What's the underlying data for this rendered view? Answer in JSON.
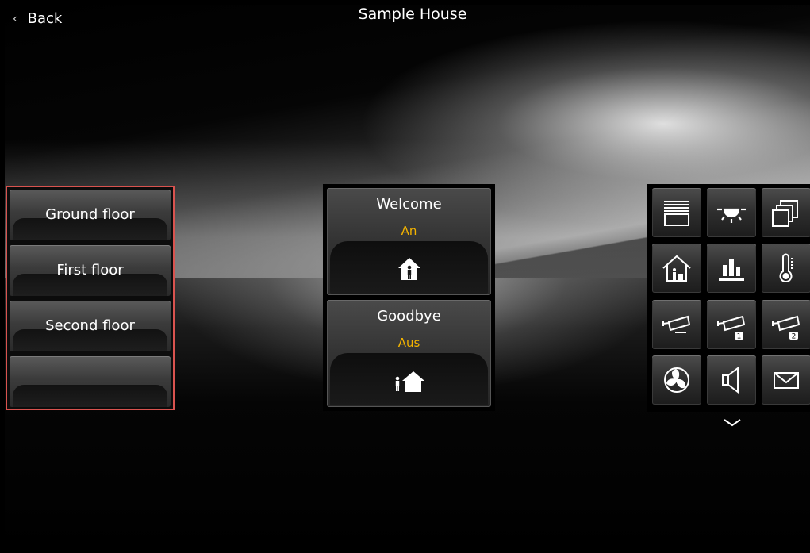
{
  "header": {
    "back_label": "Back",
    "title": "Sample House"
  },
  "floors": [
    {
      "label": "Ground floor"
    },
    {
      "label": "First floor"
    },
    {
      "label": "Second floor"
    },
    {
      "label": ""
    }
  ],
  "scenes": [
    {
      "name": "Welcome",
      "state": "An",
      "icon": "person-in-house-icon"
    },
    {
      "name": "Goodbye",
      "state": "Aus",
      "icon": "person-leaving-house-icon"
    }
  ],
  "function_icons": [
    "blinds-icon",
    "light-icon",
    "multi-window-icon",
    "house-presence-icon",
    "bar-chart-icon",
    "thermometer-icon",
    "camera-icon",
    "camera-1-icon",
    "camera-2-icon",
    "fan-icon",
    "speaker-icon",
    "mail-icon"
  ],
  "colors": {
    "selection_border": "#d9534f",
    "state_text": "#f4b400"
  }
}
